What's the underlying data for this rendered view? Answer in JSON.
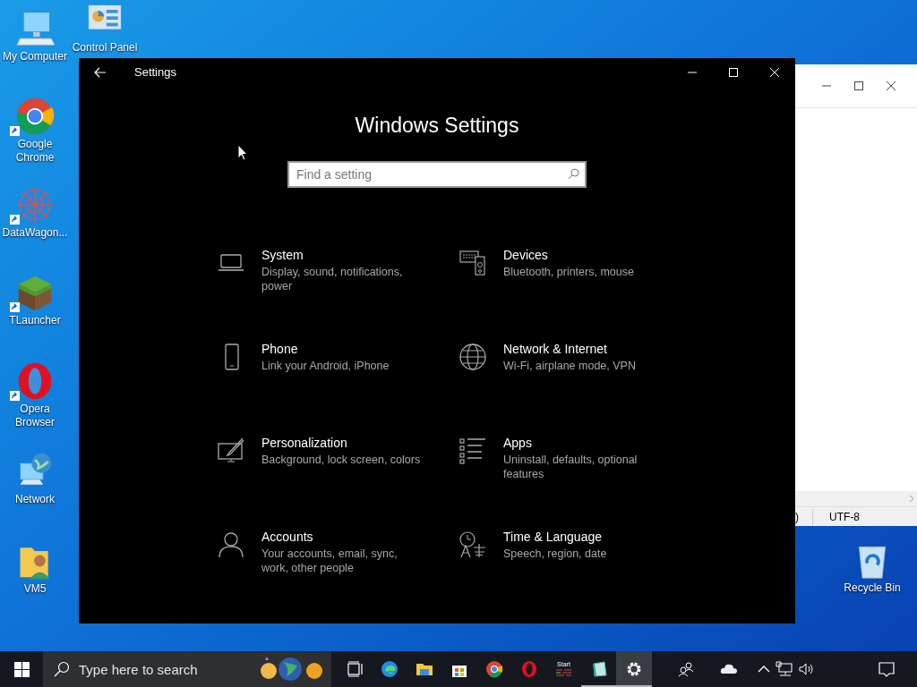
{
  "desktop_icons": [
    {
      "label": "My Computer",
      "kind": "computer"
    },
    {
      "label": "Google Chrome",
      "kind": "chrome",
      "shortcut": true
    },
    {
      "label": "DataWagon...",
      "kind": "snowflake",
      "shortcut": true
    },
    {
      "label": "TLauncher",
      "kind": "block",
      "shortcut": true
    },
    {
      "label": "Opera Browser",
      "kind": "opera",
      "shortcut": true
    },
    {
      "label": "Network",
      "kind": "network"
    },
    {
      "label": "VM5",
      "kind": "user-folder"
    },
    {
      "label": "Control Panel",
      "kind": "control-panel"
    },
    {
      "label": "Recycle Bin",
      "kind": "recycle"
    }
  ],
  "background_window": {
    "status_bar": [
      ")",
      "UTF-8"
    ]
  },
  "settings_window": {
    "title": "Settings",
    "heading": "Windows Settings",
    "search": {
      "placeholder": "Find a setting"
    },
    "categories": [
      {
        "title": "System",
        "description": "Display, sound, notifications, power",
        "kind": "laptop"
      },
      {
        "title": "Devices",
        "description": "Bluetooth, printers, mouse",
        "kind": "devices"
      },
      {
        "title": "Phone",
        "description": "Link your Android, iPhone",
        "kind": "phone"
      },
      {
        "title": "Network & Internet",
        "description": "Wi-Fi, airplane mode, VPN",
        "kind": "globe"
      },
      {
        "title": "Personalization",
        "description": "Background, lock screen, colors",
        "kind": "brush"
      },
      {
        "title": "Apps",
        "description": "Uninstall, defaults, optional features",
        "kind": "apps"
      },
      {
        "title": "Accounts",
        "description": "Your accounts, email, sync, work, other people",
        "kind": "person"
      },
      {
        "title": "Time & Language",
        "description": "Speech, region, date",
        "kind": "time"
      }
    ]
  },
  "taskbar": {
    "search": {
      "placeholder": "Type here to search"
    },
    "apps": [
      {
        "kind": "taskview",
        "running": false,
        "selected": false
      },
      {
        "kind": "edge",
        "running": false,
        "selected": false
      },
      {
        "kind": "folder",
        "running": false,
        "selected": false
      },
      {
        "kind": "store",
        "running": false,
        "selected": false
      },
      {
        "kind": "chrome",
        "running": false,
        "selected": false
      },
      {
        "kind": "opera",
        "running": false,
        "selected": false
      },
      {
        "kind": "start-app",
        "label": "Start",
        "running": false,
        "selected": false
      },
      {
        "kind": "notepad",
        "running": true,
        "selected": false
      },
      {
        "kind": "gear",
        "running": true,
        "selected": true
      }
    ]
  }
}
